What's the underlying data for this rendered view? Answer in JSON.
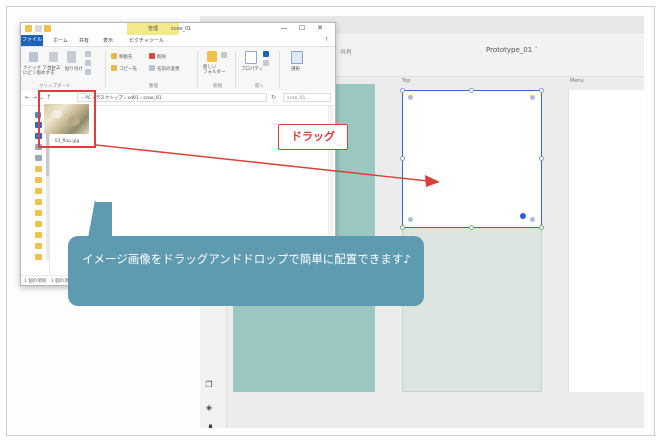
{
  "prototype_app": {
    "share_label": "共有",
    "document_name": "Prototype_01",
    "document_suffix": "˅",
    "artboard_labels": {
      "top": "Top",
      "menu": "Menu"
    }
  },
  "explorer": {
    "contextual_tab": "管理",
    "window_title": "scoe_01",
    "window_buttons": {
      "minimize": "—",
      "maximize": "☐",
      "close": "✕"
    },
    "ribbon_tabs": {
      "file": "ファイル",
      "home": "ホーム",
      "share": "共有",
      "view": "表示",
      "picture_tools": "ピクチャツール"
    },
    "ribbon": {
      "pin": "クイック アクセス\nにピン留めする",
      "copy": "コピー",
      "paste": "貼り付け",
      "move_to": "移動先",
      "delete": "削除",
      "copy_to": "コピー先",
      "rename": "名前の変更",
      "new_folder": "新しい\nフォルダー",
      "properties": "プロパティ",
      "select": "選択",
      "groups": {
        "clipboard": "クリップボード",
        "organize": "整理",
        "new": "新規",
        "open": "開く"
      }
    },
    "address_path": "›  PC  ›  デスクトップ  ›  xd01  ›  scoe_01",
    "search_placeholder": "scoe_01...",
    "file": {
      "caption": "03_flop.jpg"
    },
    "status_text": "1 個の項目　1 個の項目を選択"
  },
  "annotations": {
    "drag_label": "ドラッグ",
    "callout_text": "イメージ画像をドラッグアンドドロップで簡単に配置できます♪"
  },
  "colors": {
    "accent_red": "#d8403a",
    "callout_blue": "#5f9bb0",
    "artboard_teal": "#9bc6c2",
    "selection_blue": "#3c66c8"
  }
}
